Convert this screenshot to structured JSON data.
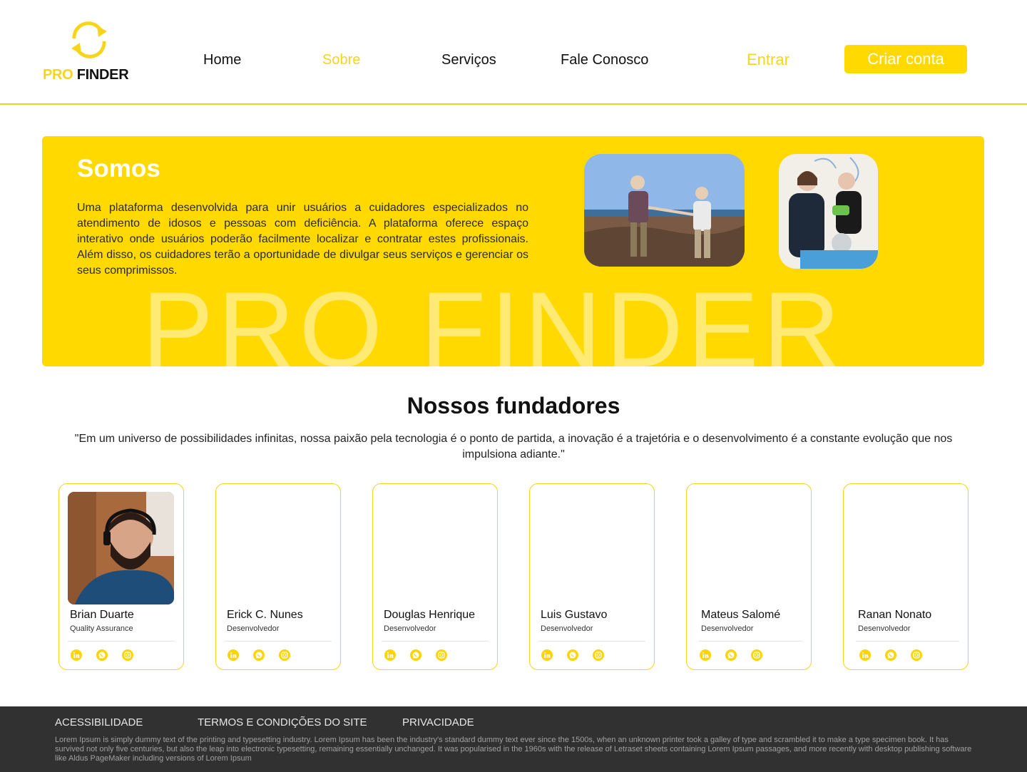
{
  "brand": {
    "pro": "PRO",
    "finder": "FINDER"
  },
  "nav": [
    {
      "label": "Home",
      "active": false
    },
    {
      "label": "Sobre",
      "active": true
    },
    {
      "label": "Serviços",
      "active": false
    },
    {
      "label": "Fale Conosco",
      "active": false
    }
  ],
  "auth": {
    "login": "Entrar",
    "signup": "Criar conta"
  },
  "hero": {
    "title": "Somos",
    "text": "Uma plataforma desenvolvida para unir usuários a cuidadores especializados no atendimento de idosos e pessoas com deficiência. A plataforma oferece espaço interativo onde usuários poderão facilmente localizar e contratar estes profissionais. Além disso, os cuidadores terão a oportunidade de divulgar seus serviços e gerenciar os seus comprimissos.",
    "watermark": "PRO FINDER"
  },
  "founders": {
    "title": "Nossos fundadores",
    "quote": "\"Em um universo de possibilidades infinitas, nossa paixão pela tecnologia é o ponto de partida, a inovação é a trajetória e o desenvolvimento é a constante evolução que nos impulsiona adiante.\"",
    "members": [
      {
        "name": "Brian Duarte",
        "role": "Quality Assurance"
      },
      {
        "name": "Erick C. Nunes",
        "role": "Desenvolvedor"
      },
      {
        "name": "Douglas Henrique",
        "role": "Desenvolvedor"
      },
      {
        "name": "Luis Gustavo",
        "role": "Desenvolvedor"
      },
      {
        "name": "Mateus Salomé",
        "role": "Desenvolvedor"
      },
      {
        "name": "Ranan Nonato",
        "role": "Desenvolvedor"
      }
    ],
    "social_icons": [
      "linkedin-icon",
      "whatsapp-icon",
      "instagram-icon"
    ]
  },
  "footer": {
    "links": [
      "ACESSIBILIDADE",
      "TERMOS E CONDIÇÕES DO SITE",
      "PRIVACIDADE"
    ],
    "text": "Lorem Ipsum is simply dummy text of the printing and typesetting industry. Lorem Ipsum has been the industry's standard dummy text ever since the 1500s, when an unknown printer took a galley of type and scrambled it to make a type specimen book. It has survived not only five centuries, but also the leap into electronic typesetting, remaining essentially unchanged. It was popularised in the 1960s with the release of Letraset sheets containing Lorem Ipsum passages, and more recently with desktop publishing software like Aldus PageMaker including versions of Lorem Ipsum"
  },
  "colors": {
    "accent": "#ffd900",
    "footer_bg": "#313131"
  }
}
